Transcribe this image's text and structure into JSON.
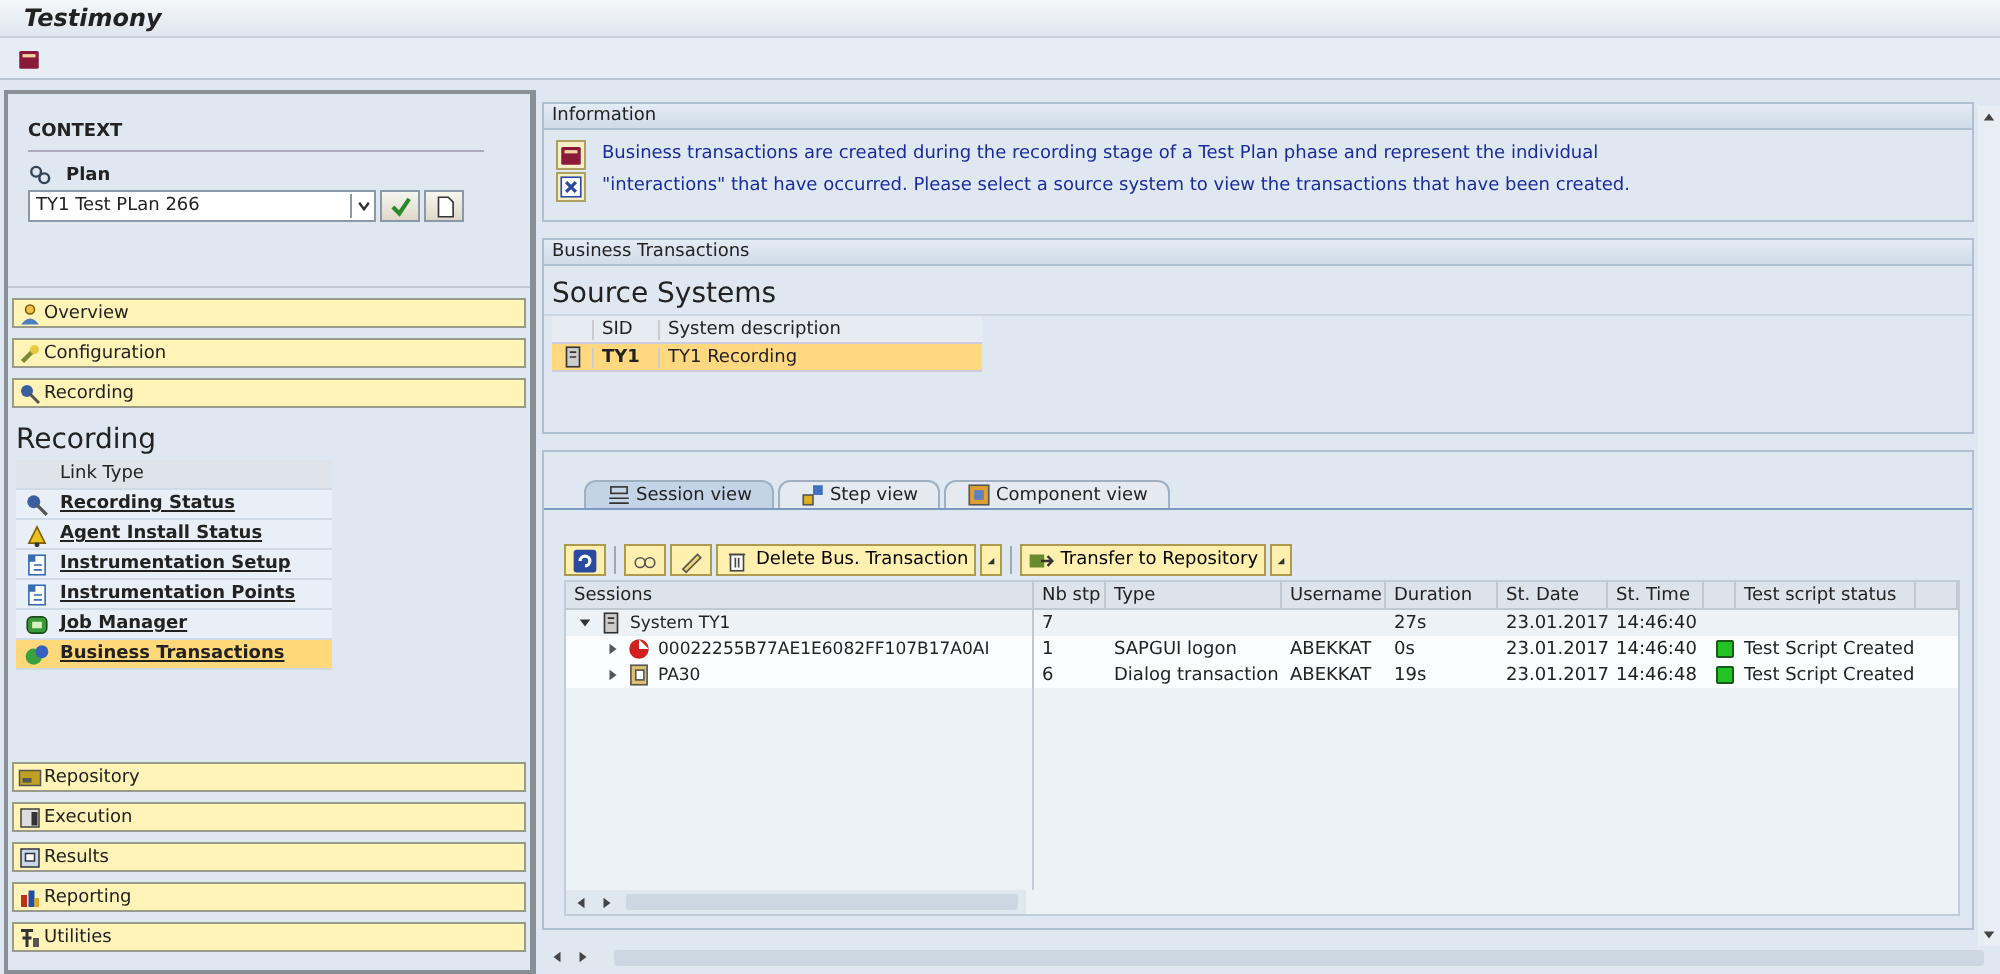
{
  "window": {
    "title": "Testimony"
  },
  "context": {
    "heading": "CONTEXT",
    "plan_label": "Plan",
    "plan_value": "TY1 Test PLan 266"
  },
  "nav_top": [
    {
      "label": "Overview"
    },
    {
      "label": "Configuration"
    },
    {
      "label": "Recording"
    }
  ],
  "section_title": "Recording",
  "link_table": {
    "column": "Link Type",
    "rows": [
      {
        "label": "Recording Status",
        "selected": false
      },
      {
        "label": "Agent Install Status",
        "selected": false
      },
      {
        "label": "Instrumentation Setup",
        "selected": false
      },
      {
        "label": "Instrumentation Points",
        "selected": false
      },
      {
        "label": "Job Manager",
        "selected": false
      },
      {
        "label": "Business Transactions",
        "selected": true
      }
    ]
  },
  "nav_bottom": [
    {
      "label": "Repository"
    },
    {
      "label": "Execution"
    },
    {
      "label": "Results"
    },
    {
      "label": "Reporting"
    },
    {
      "label": "Utilities"
    }
  ],
  "information": {
    "title": "Information",
    "lines": [
      "Business transactions are created during the recording stage of a Test Plan phase and represent the individual",
      "\"interactions\" that have occurred. Please select a source system to view the transactions that have been created."
    ]
  },
  "business_transactions": {
    "title": "Business Transactions",
    "heading": "Source Systems",
    "columns": [
      "SID",
      "System description"
    ],
    "rows": [
      {
        "sid": "TY1",
        "description": "TY1 Recording",
        "selected": true
      }
    ]
  },
  "tabs": [
    {
      "label": "Session view",
      "selected": true
    },
    {
      "label": "Step view",
      "selected": false
    },
    {
      "label": "Component view",
      "selected": false
    }
  ],
  "toolbar": {
    "delete": "Delete Bus. Transaction",
    "transfer": "Transfer to Repository"
  },
  "sessions": {
    "columns": [
      "Sessions",
      "Nb stp",
      "Type",
      "Username",
      "Duration",
      "St. Date",
      "St. Time",
      "Test script status"
    ],
    "rows": [
      {
        "name": "System TY1",
        "expanded": true,
        "nb_stp": "7",
        "type": "",
        "username": "",
        "duration": "27s",
        "date": "23.01.2017",
        "time": "14:46:40",
        "children": [
          {
            "name": "00022255B77AE1E6082FF107B17A0AI",
            "expanded": false,
            "nb_stp": "1",
            "type": "SAPGUI logon",
            "username": "ABEKKAT",
            "duration": "0s",
            "date": "23.01.2017",
            "time": "14:46:40",
            "status": "Test Script Created",
            "color": "#22c322"
          },
          {
            "name": "PA30",
            "expanded": false,
            "nb_stp": "6",
            "type": "Dialog transaction",
            "username": "ABEKKAT",
            "duration": "19s",
            "date": "23.01.2017",
            "time": "14:46:48",
            "status": "Test Script Created",
            "color": "#22c322"
          }
        ]
      }
    ]
  }
}
